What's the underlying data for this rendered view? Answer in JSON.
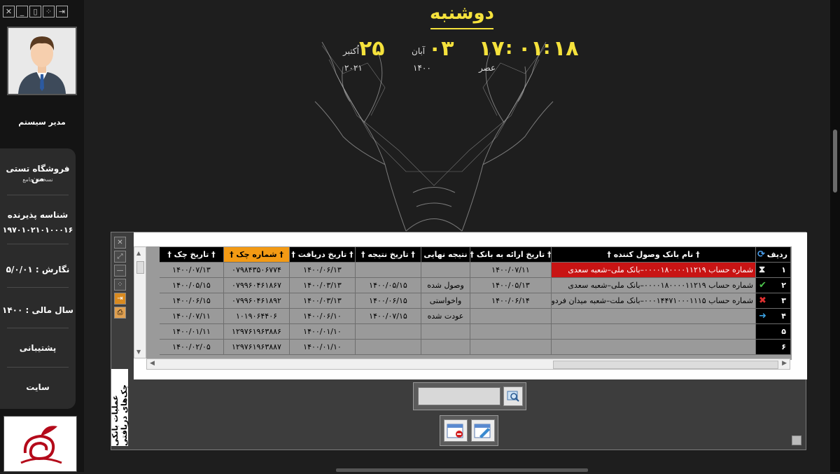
{
  "header": {
    "day_name": "دوشنبه",
    "hour": "۱۸",
    "minute": "۰۱",
    "second": "۱۷",
    "ampm": "عصر",
    "persian_day": "۰۳",
    "persian_month": "آبان",
    "persian_year": "۱۴۰۰",
    "greg_day": "۲۵",
    "greg_month": "اُکتبر",
    "greg_year": "۲۰۲۱"
  },
  "user": {
    "name": "مدیر سیستم"
  },
  "sidebar": {
    "store_name": "فروشگاه تستی من",
    "store_sub": "نسخه‌ی جامع",
    "terminal_label": "شناسه پذیرنده",
    "terminal_id": "۱۹۷۰۱۰۲۱۰۱۰۰۰۱۶",
    "version": "نگارش : ۵/۰/۰۱",
    "fiscal_year": "سال مالی : ۱۴۰۰",
    "support": "پشتیبانی",
    "site": "سایت"
  },
  "form": {
    "title": "عملیات بانکی چک‌های دریافتی",
    "grid": {
      "columns": [
        {
          "key": "row",
          "label": "ردیف"
        },
        {
          "key": "bank",
          "label": "† نام بانک وصول کننده †"
        },
        {
          "key": "submit",
          "label": "† تاریخ ارائه به بانک †"
        },
        {
          "key": "result",
          "label": "نتیجه نهایی"
        },
        {
          "key": "result_date",
          "label": "† تاریخ نتیجه †"
        },
        {
          "key": "receive_date",
          "label": "† تاریخ دریافت †"
        },
        {
          "key": "check_no",
          "label": "† شماره چک †"
        },
        {
          "key": "check_date",
          "label": "† تاریخ چک †"
        }
      ],
      "rows": [
        {
          "row": "۱",
          "status": "pending",
          "bank": "شماره حساب ۰۰۰۰۱۸۰۰۰۰۱۱۲۱۹–بانک ملی–شعبه سعدی",
          "submit": "۱۴۰۰/۰۷/۱۱",
          "result": "",
          "result_date": "",
          "receive_date": "۱۴۰۰/۰۶/۱۳",
          "check_no": "۰۷۹۸۴۳۵۰۶۷۷۴",
          "check_date": "۱۴۰۰/۰۷/۱۳"
        },
        {
          "row": "۲",
          "status": "done",
          "bank": "شماره حساب ۰۰۰۰۱۸۰۰۰۰۱۱۲۱۹–بانک ملی–شعبه سعدی",
          "submit": "۱۴۰۰/۰۵/۱۳",
          "result": "وصول شده",
          "result_date": "۱۴۰۰/۰۵/۱۵",
          "receive_date": "۱۴۰۰/۰۳/۱۳",
          "check_no": "۰۷۹۹۶۰۴۶۱۸۶۷",
          "check_date": "۱۴۰۰/۰۵/۱۵"
        },
        {
          "row": "۳",
          "status": "failed",
          "bank": "شماره حساب ۰۰۰۱۴۴۷۱۰۰۰۱۱۱۵–بانک ملت–شعبه میدان فردوسی",
          "submit": "۱۴۰۰/۰۶/۱۴",
          "result": "واخواستی",
          "result_date": "۱۴۰۰/۰۶/۱۵",
          "receive_date": "۱۴۰۰/۰۳/۱۳",
          "check_no": "۰۷۹۹۶۰۴۶۱۸۹۲",
          "check_date": "۱۴۰۰/۰۶/۱۵"
        },
        {
          "row": "۴",
          "status": "returned",
          "bank": "",
          "submit": "",
          "result": "عودت شده",
          "result_date": "۱۴۰۰/۰۷/۱۵",
          "receive_date": "۱۴۰۰/۰۶/۱۰",
          "check_no": "۱۰۱۹۰۶۴۴۰۶",
          "check_date": "۱۴۰۰/۰۷/۱۱"
        },
        {
          "row": "۵",
          "status": "none",
          "bank": "",
          "submit": "",
          "result": "",
          "result_date": "",
          "receive_date": "۱۴۰۰/۰۱/۱۰",
          "check_no": "۱۲۹۷۶۱۹۶۳۸۸۶",
          "check_date": "۱۴۰۰/۰۱/۱۱"
        },
        {
          "row": "۶",
          "status": "none",
          "bank": "",
          "submit": "",
          "result": "",
          "result_date": "",
          "receive_date": "۱۴۰۰/۰۱/۱۰",
          "check_no": "۱۲۹۷۶۱۹۶۳۸۸۷",
          "check_date": "۱۴۰۰/۰۲/۰۵"
        }
      ]
    }
  },
  "colors": {
    "accent": "#f5e23c",
    "selected_row": "#c81414",
    "sorted_header": "#f39a14"
  }
}
